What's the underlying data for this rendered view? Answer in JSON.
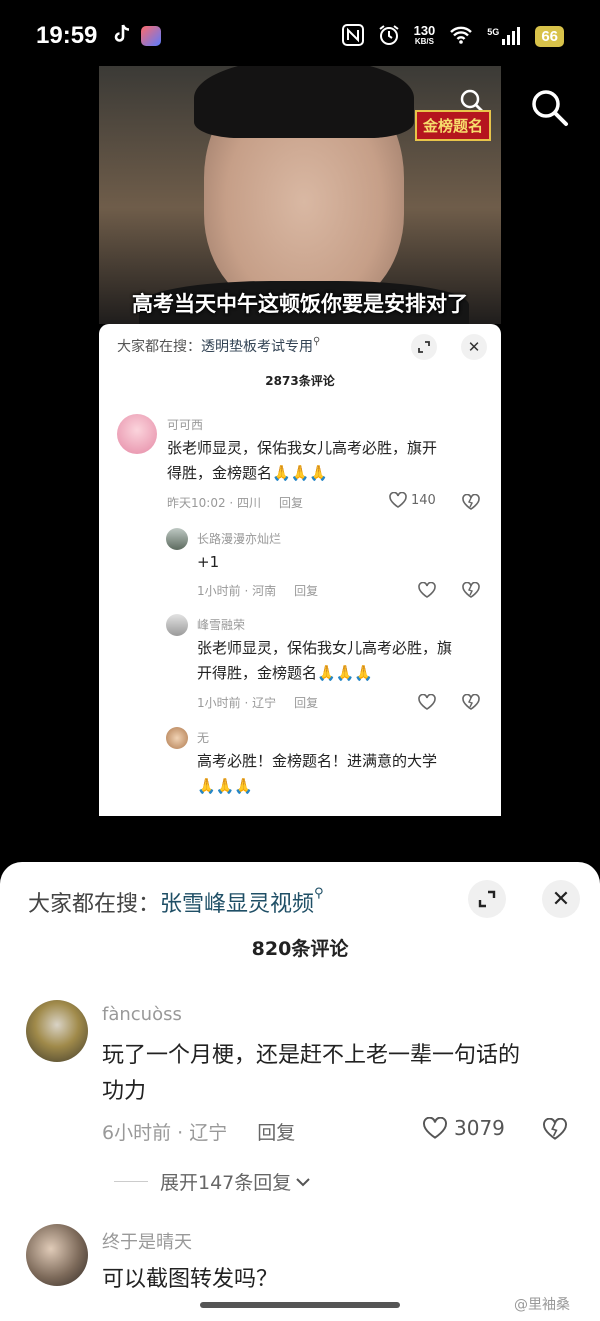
{
  "status_bar": {
    "time": "19:59",
    "net_speed": "130",
    "net_unit": "KB/S",
    "signal_label": "5G",
    "battery": "66"
  },
  "inner": {
    "subtitle": "高考当天中午这顿饭你要是安排对了",
    "badge": "金榜题名",
    "search_prefix": "大家都在搜：",
    "search_query": "透明垫板考试专用",
    "comment_count": "2873条评论",
    "comments": [
      {
        "user": "可可西",
        "text_line1": "张老师显灵，保佑我女儿高考必胜，旗开",
        "text_line2": "得胜，金榜题名🙏🙏🙏",
        "time": "昨天10:02 · 四川",
        "reply": "回复",
        "likes": "140"
      },
      {
        "user": "长路漫漫亦灿烂",
        "text_line1": "+1",
        "time": "1小时前 · 河南",
        "reply": "回复"
      },
      {
        "user": "峰雪融荣",
        "text_line1": "张老师显灵，保佑我女儿高考必胜，旗",
        "text_line2": "开得胜，金榜题名🙏🙏🙏",
        "time": "1小时前 · 辽宁",
        "reply": "回复"
      },
      {
        "user": "无",
        "text_line1": "高考必胜！金榜题名！进满意的大学",
        "text_line2": "🙏🙏🙏"
      }
    ]
  },
  "sheet": {
    "search_prefix": "大家都在搜：",
    "search_query": "张雪峰显灵视频",
    "comment_count": "820条评论",
    "comments": [
      {
        "user": "fàncuòss",
        "text_line1": "玩了一个月梗，还是赶不上老一辈一句话的",
        "text_line2": "功力",
        "time": "6小时前 · 辽宁",
        "reply": "回复",
        "likes": "3079"
      },
      {
        "user": "终于是晴天",
        "text_line1": "可以截图转发吗？"
      }
    ],
    "expand_replies": "展开147条回复"
  },
  "watermark": "@里袖桑"
}
